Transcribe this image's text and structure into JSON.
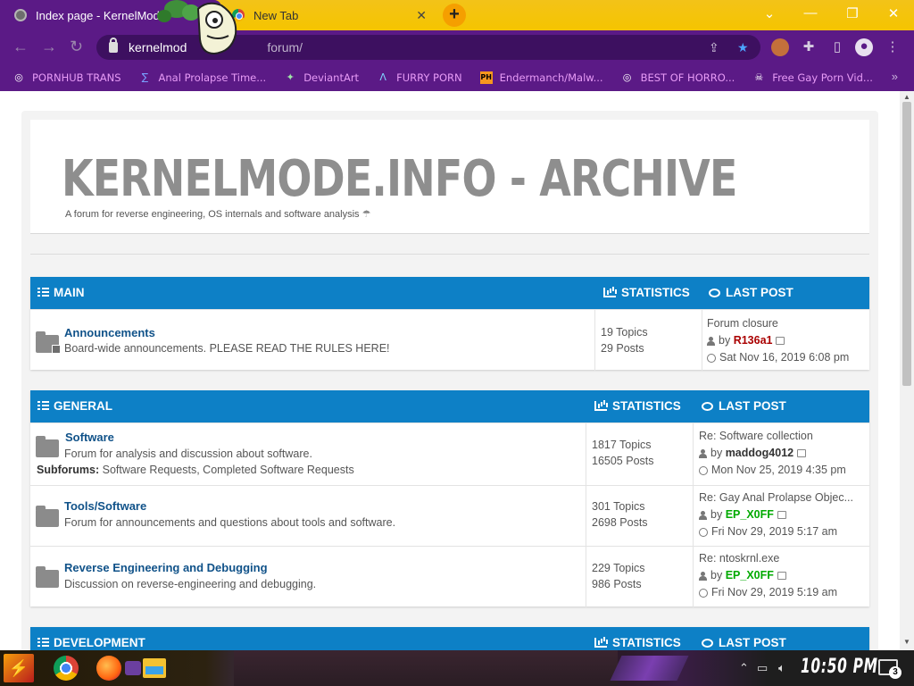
{
  "browser": {
    "tabs": [
      {
        "title": "Index page - KernelMod",
        "active": true
      },
      {
        "title": "New Tab",
        "active": false
      }
    ],
    "new_tab_label": "+",
    "address": {
      "prefix": "kernelmod",
      "suffix": "forum/"
    },
    "bookmarks": [
      {
        "label": "PORNHUB TRANS",
        "icon": "globe-icon"
      },
      {
        "label": "Anal Prolapse Time...",
        "icon": "bookmark-icon"
      },
      {
        "label": "DeviantArt",
        "icon": "deviantart-icon"
      },
      {
        "label": "FURRY PORN",
        "icon": "lambda-icon"
      },
      {
        "label": "Endermanch/Malw...",
        "icon": "ph-icon"
      },
      {
        "label": "BEST OF HORRO...",
        "icon": "globe-icon"
      },
      {
        "label": "Free Gay Porn Vid...",
        "icon": "skull-icon"
      }
    ]
  },
  "site": {
    "title": "KERNELMODE.INFO - ARCHIVE",
    "description": "A forum for reverse engineering, OS internals and software analysis"
  },
  "categories": [
    {
      "name": "MAIN",
      "stats_label": "STATISTICS",
      "last_label": "LAST POST",
      "forums": [
        {
          "title": "Announcements",
          "description": "Board-wide announcements. PLEASE READ THE RULES HERE!",
          "topics": "19 Topics",
          "posts": "29 Posts",
          "last_title": "Forum closure",
          "last_by": "by",
          "last_user": "R136a1",
          "last_user_color": "#aa0000",
          "last_date": "Sat Nov 16, 2019 6:08 pm",
          "locked": true
        }
      ]
    },
    {
      "name": "GENERAL",
      "stats_label": "STATISTICS",
      "last_label": "LAST POST",
      "forums": [
        {
          "title": "Software",
          "description": "Forum for analysis and discussion about software.",
          "subforums_label": "Subforums:",
          "subforums": "Software Requests, Completed Software Requests",
          "topics": "1817 Topics",
          "posts": "16505 Posts",
          "last_title": "Re: Software collection",
          "last_by": "by",
          "last_user": "maddog4012",
          "last_user_color": "#333333",
          "last_date": "Mon Nov 25, 2019 4:35 pm",
          "locked": false
        },
        {
          "title": "Tools/Software",
          "description": "Forum for announcements and questions about tools and software.",
          "topics": "301 Topics",
          "posts": "2698 Posts",
          "last_title": "Re: Gay Anal Prolapse Objec...",
          "last_by": "by",
          "last_user": "EP_X0FF",
          "last_user_color": "#00aa00",
          "last_date": "Fri Nov 29, 2019 5:17 am",
          "locked": false
        },
        {
          "title": "Reverse Engineering and Debugging",
          "description": "Discussion on reverse-engineering and debugging.",
          "topics": "229 Topics",
          "posts": "986 Posts",
          "last_title": "Re: ntoskrnl.exe",
          "last_by": "by",
          "last_user": "EP_X0FF",
          "last_user_color": "#00aa00",
          "last_date": "Fri Nov 29, 2019 5:19 am",
          "locked": false
        }
      ]
    },
    {
      "name": "DEVELOPMENT",
      "stats_label": "STATISTICS",
      "last_label": "LAST POST",
      "forums": []
    }
  ],
  "taskbar": {
    "clock": "10:50 PM",
    "notifications": "3"
  },
  "colors": {
    "accent": "#0d80c6",
    "browser_theme": "#5b1a86",
    "tabbar": "#f5c400"
  }
}
